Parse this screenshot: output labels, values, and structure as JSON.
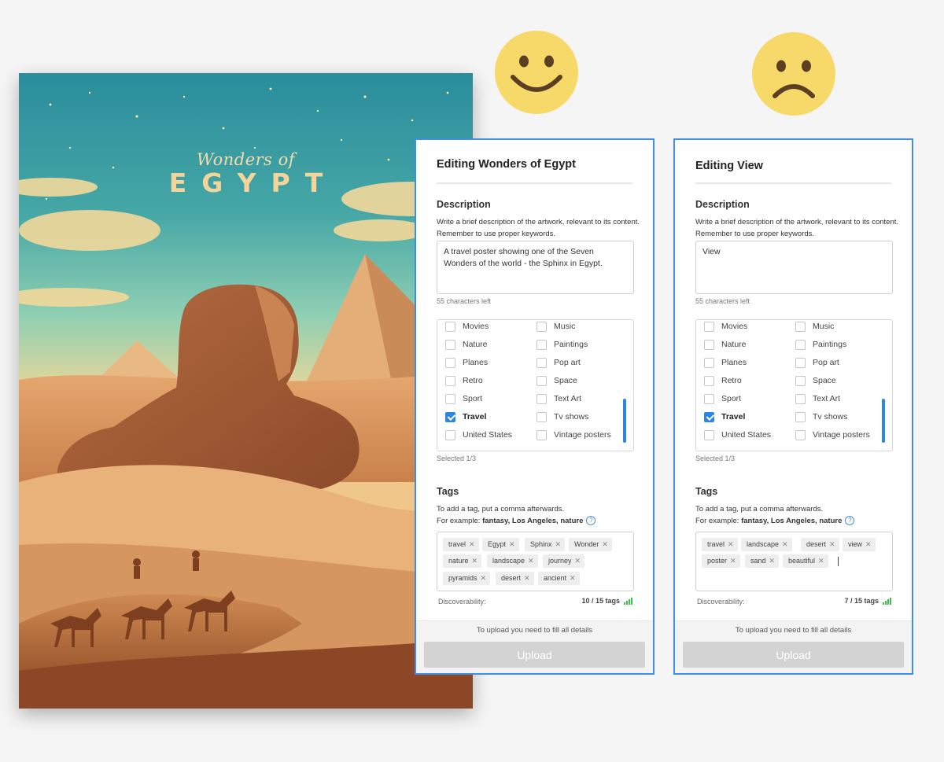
{
  "poster": {
    "subtitle": "Wonders of",
    "title": "EGYPT"
  },
  "faces": [
    {
      "icon": "happy-face-icon",
      "color": "#f7d96a"
    },
    {
      "icon": "sad-face-icon",
      "color": "#f7d96a"
    }
  ],
  "panels": [
    {
      "title": "Editing Wonders of Egypt",
      "description_heading": "Description",
      "description_hint_1": "Write a brief description of the artwork, relevant to its content.",
      "description_hint_2": "Remember to use proper keywords.",
      "description_value": "A travel poster showing one of the Seven Wonders of the world -  the Sphinx in Egypt.",
      "chars_left": "55 characters left",
      "categories_left": [
        {
          "label": "Movies",
          "checked": false
        },
        {
          "label": "Nature",
          "checked": false
        },
        {
          "label": "Planes",
          "checked": false
        },
        {
          "label": "Retro",
          "checked": false
        },
        {
          "label": "Sport",
          "checked": false
        },
        {
          "label": "Travel",
          "checked": true
        },
        {
          "label": "United States",
          "checked": false
        }
      ],
      "categories_right": [
        {
          "label": "Music",
          "checked": false
        },
        {
          "label": "Paintings",
          "checked": false
        },
        {
          "label": "Pop art",
          "checked": false
        },
        {
          "label": "Space",
          "checked": false
        },
        {
          "label": "Text Art",
          "checked": false
        },
        {
          "label": "Tv shows",
          "checked": false
        },
        {
          "label": "Vintage posters",
          "checked": false
        }
      ],
      "selected_count": "Selected 1/3",
      "tags_heading": "Tags",
      "tags_hint_1": "To add a tag, put a comma afterwards.",
      "tags_hint_2_prefix": "For example: ",
      "tags_hint_2_example": "fantasy, Los Angeles, nature",
      "tags": [
        "travel",
        "Egypt",
        "Sphinx",
        "Wonder",
        "nature",
        "landscape",
        "journey",
        "pyramids",
        "desert",
        "ancient"
      ],
      "discoverability_label": "Discoverability:",
      "tag_count": "10 / 15 tags",
      "footer_note": "To upload you need to fill all details",
      "upload_label": "Upload"
    },
    {
      "title": "Editing View",
      "description_heading": "Description",
      "description_hint_1": "Write a brief description of the artwork, relevant to its content.",
      "description_hint_2": "Remember to use proper keywords.",
      "description_value": "View",
      "chars_left": "55 characters left",
      "categories_left": [
        {
          "label": "Movies",
          "checked": false
        },
        {
          "label": "Nature",
          "checked": false
        },
        {
          "label": "Planes",
          "checked": false
        },
        {
          "label": "Retro",
          "checked": false
        },
        {
          "label": "Sport",
          "checked": false
        },
        {
          "label": "Travel",
          "checked": true
        },
        {
          "label": "United States",
          "checked": false
        }
      ],
      "categories_right": [
        {
          "label": "Music",
          "checked": false
        },
        {
          "label": "Paintings",
          "checked": false
        },
        {
          "label": "Pop art",
          "checked": false
        },
        {
          "label": "Space",
          "checked": false
        },
        {
          "label": "Text Art",
          "checked": false
        },
        {
          "label": "Tv shows",
          "checked": false
        },
        {
          "label": "Vintage posters",
          "checked": false
        }
      ],
      "selected_count": "Selected 1/3",
      "tags_heading": "Tags",
      "tags_hint_1": "To add a tag, put a comma afterwards.",
      "tags_hint_2_prefix": "For example: ",
      "tags_hint_2_example": "fantasy, Los Angeles, nature",
      "tags": [
        "travel",
        "landscape",
        "desert",
        "view",
        "poster",
        "sand",
        "beautiful"
      ],
      "discoverability_label": "Discoverability:",
      "tag_count": "7 / 15 tags",
      "footer_note": "To upload you need to fill all details",
      "upload_label": "Upload"
    }
  ]
}
